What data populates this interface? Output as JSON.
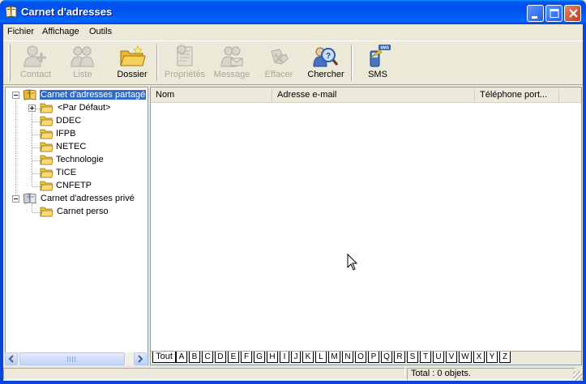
{
  "window": {
    "title": "Carnet d'adresses"
  },
  "menu": [
    "Fichier",
    "Affichage",
    "Outils"
  ],
  "toolbar": [
    {
      "label": "Contact",
      "icon": "contact-icon",
      "enabled": false
    },
    {
      "label": "Liste",
      "icon": "group-icon",
      "enabled": false
    },
    {
      "label": "Dossier",
      "icon": "folder-icon",
      "enabled": true
    },
    {
      "label": "Propriétés",
      "icon": "properties-icon",
      "enabled": false
    },
    {
      "label": "Message",
      "icon": "message-icon",
      "enabled": false
    },
    {
      "label": "Effacer",
      "icon": "delete-icon",
      "enabled": false
    },
    {
      "label": "Chercher",
      "icon": "find-icon",
      "enabled": true
    },
    {
      "label": "SMS",
      "icon": "sms-icon",
      "enabled": true,
      "badge": "SMS"
    }
  ],
  "tree": {
    "shared": {
      "label": "Carnet d'adresses partagé",
      "children": [
        "<Par Défaut>",
        "DDEC",
        "IFPB",
        "NETEC",
        "Technologie",
        "TICE",
        "CNFETP"
      ]
    },
    "private": {
      "label": "Carnet d'adresses privé",
      "children": [
        "Carnet perso"
      ]
    }
  },
  "list": {
    "columns": [
      "Nom",
      "Adresse e-mail",
      "Téléphone port..."
    ]
  },
  "alphabet_tabs": [
    "Tout",
    "A",
    "B",
    "C",
    "D",
    "E",
    "F",
    "G",
    "H",
    "I",
    "J",
    "K",
    "L",
    "M",
    "N",
    "O",
    "P",
    "Q",
    "R",
    "S",
    "T",
    "U",
    "V",
    "W",
    "X",
    "Y",
    "Z"
  ],
  "status": {
    "total": "Total : 0 objets."
  },
  "colors": {
    "titlebar": "#0054E3",
    "selection": "#316AC5",
    "background": "#ECE9D8"
  }
}
